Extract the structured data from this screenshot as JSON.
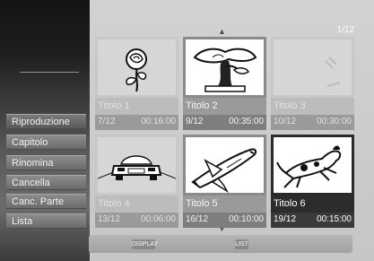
{
  "menu": {
    "items": [
      {
        "label": "Riproduzione"
      },
      {
        "label": "Capitolo"
      },
      {
        "label": "Rinomina"
      },
      {
        "label": "Cancella"
      },
      {
        "label": "Canc. Parte"
      },
      {
        "label": "Lista"
      }
    ]
  },
  "header": {
    "page": "1/12"
  },
  "titles": [
    {
      "title": "Titolo 1",
      "date": "7/12",
      "duration": "00:16:00",
      "icon": "rose-icon"
    },
    {
      "title": "Titolo 2",
      "date": "9/12",
      "duration": "00:35:00",
      "icon": "bonsai-tree-icon"
    },
    {
      "title": "Titolo 3",
      "date": "10/12",
      "duration": "00:30:00",
      "icon": "blank-thumbnail"
    },
    {
      "title": "Titolo 4",
      "date": "13/12",
      "duration": "00:06:00",
      "icon": "car-icon"
    },
    {
      "title": "Titolo 5",
      "date": "16/12",
      "duration": "00:10:00",
      "icon": "space-shuttle-icon"
    },
    {
      "title": "Titolo 6",
      "date": "19/12",
      "duration": "00:15:00",
      "icon": "dog-icon"
    }
  ],
  "footer": {
    "display_label": "DISPLAY",
    "list_label": "LIST"
  }
}
